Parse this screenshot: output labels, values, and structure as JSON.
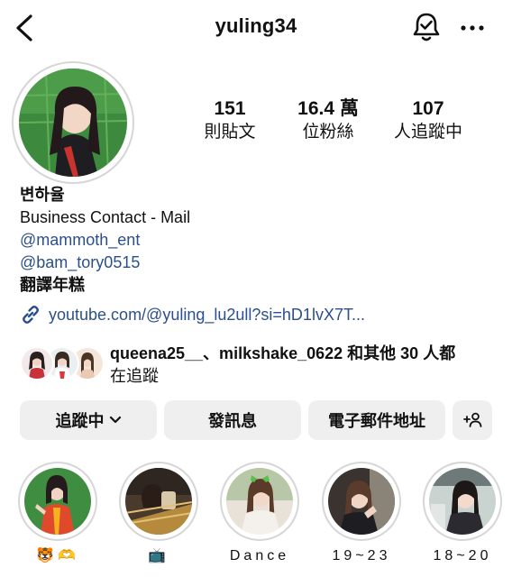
{
  "header": {
    "username": "yuling34"
  },
  "stats": [
    {
      "value": "151",
      "label": "則貼文"
    },
    {
      "value": "16.4 萬",
      "label": "位粉絲"
    },
    {
      "value": "107",
      "label": "人追蹤中"
    }
  ],
  "bio": {
    "name": "변하율",
    "line1": "Business Contact - Mail",
    "mention1": "@mammoth_ent",
    "mention2": "@bam_tory0515",
    "translate": "翻譯年糕",
    "link": "youtube.com/@yuling_lu2ull?si=hD1lvX7T..."
  },
  "followed_by": {
    "text_line1": "queena25__、milkshake_0622 和其他 30 人都",
    "text_line2": "在追蹤"
  },
  "buttons": {
    "following": "追蹤中",
    "message": "發訊息",
    "email": "電子郵件地址"
  },
  "highlights": [
    {
      "label": "🐯🫶"
    },
    {
      "label": "📺"
    },
    {
      "label": "Dance"
    },
    {
      "label": "19~23"
    },
    {
      "label": "18~20"
    }
  ],
  "colors": {
    "link": "#2b4f8e",
    "button_bg": "#efefef",
    "ring": "#d6d6d6"
  }
}
